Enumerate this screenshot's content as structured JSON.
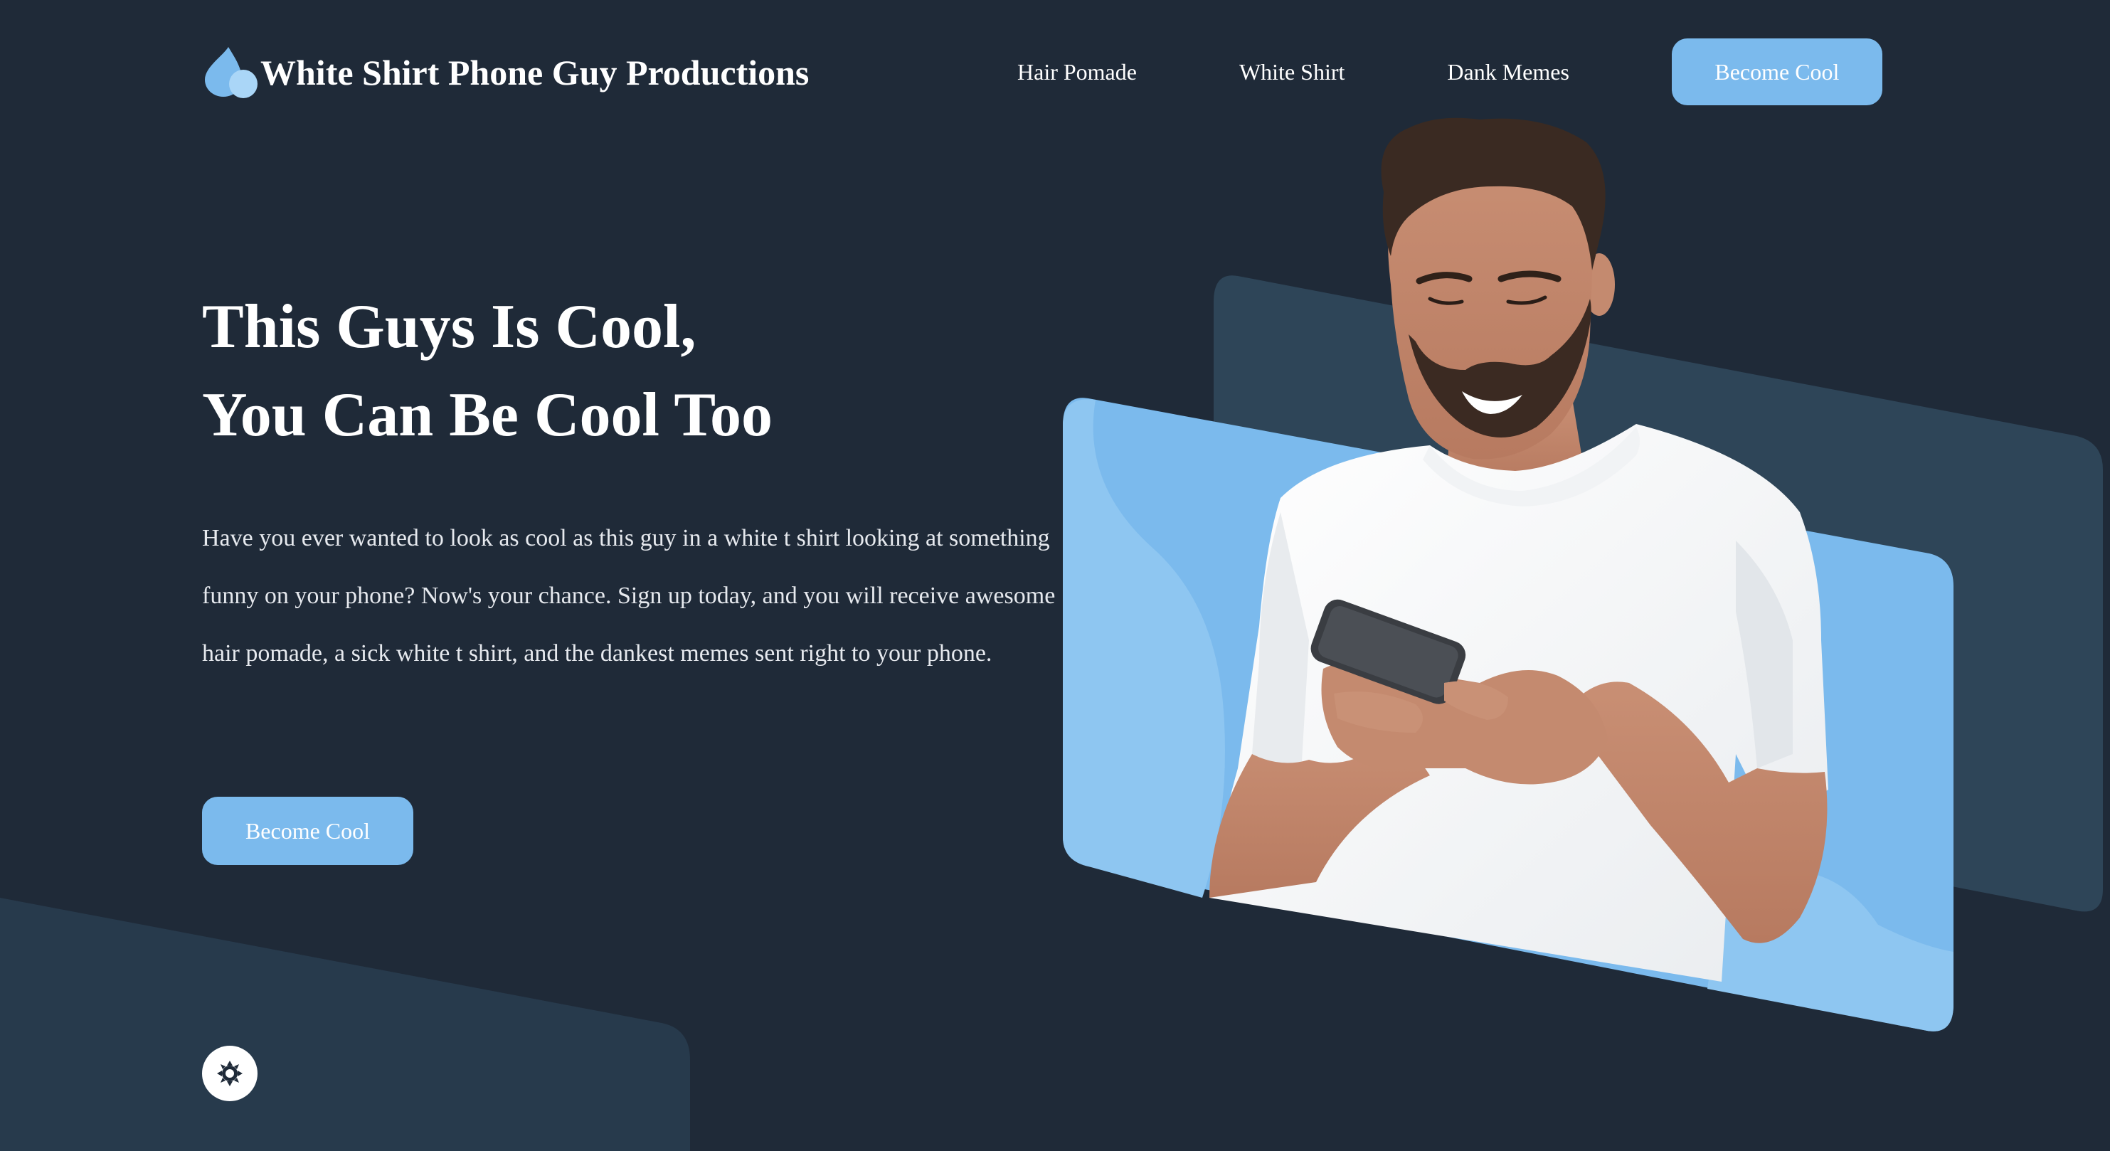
{
  "brand": {
    "logo_icon": "water-drop-icon",
    "name": "White Shirt Phone Guy Productions"
  },
  "nav": {
    "items": [
      {
        "label": "Hair Pomade"
      },
      {
        "label": "White Shirt"
      },
      {
        "label": "Dank Memes"
      }
    ],
    "cta_label": "Become Cool"
  },
  "hero": {
    "title_line1": "This Guys Is Cool,",
    "title_line2": "You Can Be Cool Too",
    "body": "Have you ever wanted to look as cool as this guy in a white t shirt looking at something funny on your phone? Now's your chance. Sign up today, and you will receive awesome hair pomade, a sick white t shirt, and the dankest memes sent right to your phone.",
    "cta_label": "Become Cool",
    "image": "man-in-white-shirt-looking-at-phone"
  },
  "theme_toggle": {
    "icon": "sun-gear-icon"
  },
  "colors": {
    "background": "#1f2a38",
    "accent": "#7bbaed",
    "panel_dark": "#2e4558",
    "panel_light": "#7bbaed",
    "text": "#ffffff"
  }
}
